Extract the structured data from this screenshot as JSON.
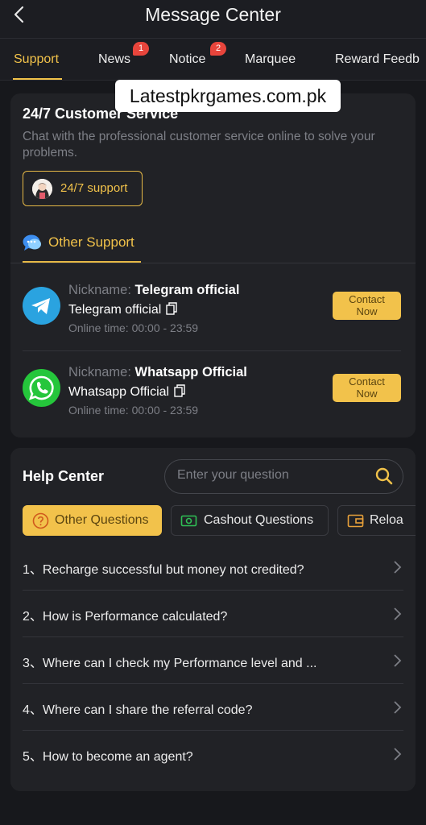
{
  "header": {
    "title": "Message Center"
  },
  "tabs": [
    {
      "label": "Support"
    },
    {
      "label": "News",
      "badge": "1"
    },
    {
      "label": "Notice",
      "badge": "2"
    },
    {
      "label": "Marquee"
    },
    {
      "label": "Reward Feedb"
    }
  ],
  "watermark": "Latestpkrgames.com.pk",
  "customer_service": {
    "title": "24/7 Customer Service",
    "description": "Chat with the professional customer service online to solve your problems.",
    "support_button": "24/7 support",
    "other_support": "Other Support"
  },
  "contacts": [
    {
      "icon": "telegram-icon",
      "nickname_label": "Nickname:",
      "nickname": "Telegram official",
      "name": "Telegram official",
      "online_time": "Online time:  00:00 - 23:59",
      "button_line1": "Contact",
      "button_line2": "Now"
    },
    {
      "icon": "whatsapp-icon",
      "nickname_label": "Nickname:",
      "nickname": "Whatsapp Official",
      "name": "Whatsapp Official",
      "online_time": "Online time:  00:00 - 23:59",
      "button_line1": "Contact",
      "button_line2": "Now"
    }
  ],
  "help_center": {
    "title": "Help Center",
    "search_placeholder": "Enter your question",
    "tabs": [
      {
        "label": "Other Questions",
        "icon": "question-circle-icon"
      },
      {
        "label": "Cashout Questions",
        "icon": "cash-icon"
      },
      {
        "label": "Reloa",
        "icon": "wallet-icon"
      }
    ],
    "questions": [
      "1、Recharge successful but money not credited?",
      "2、How is Performance calculated?",
      "3、Where can I check my Performance level and ...",
      "4、Where can I share the referral code?",
      "5、How to become an agent?"
    ]
  },
  "colors": {
    "accent": "#f1c24a",
    "background": "#17181c",
    "card": "#212226",
    "badge": "#e8453c",
    "telegram": "#2aa3e0",
    "whatsapp": "#25c63b"
  }
}
